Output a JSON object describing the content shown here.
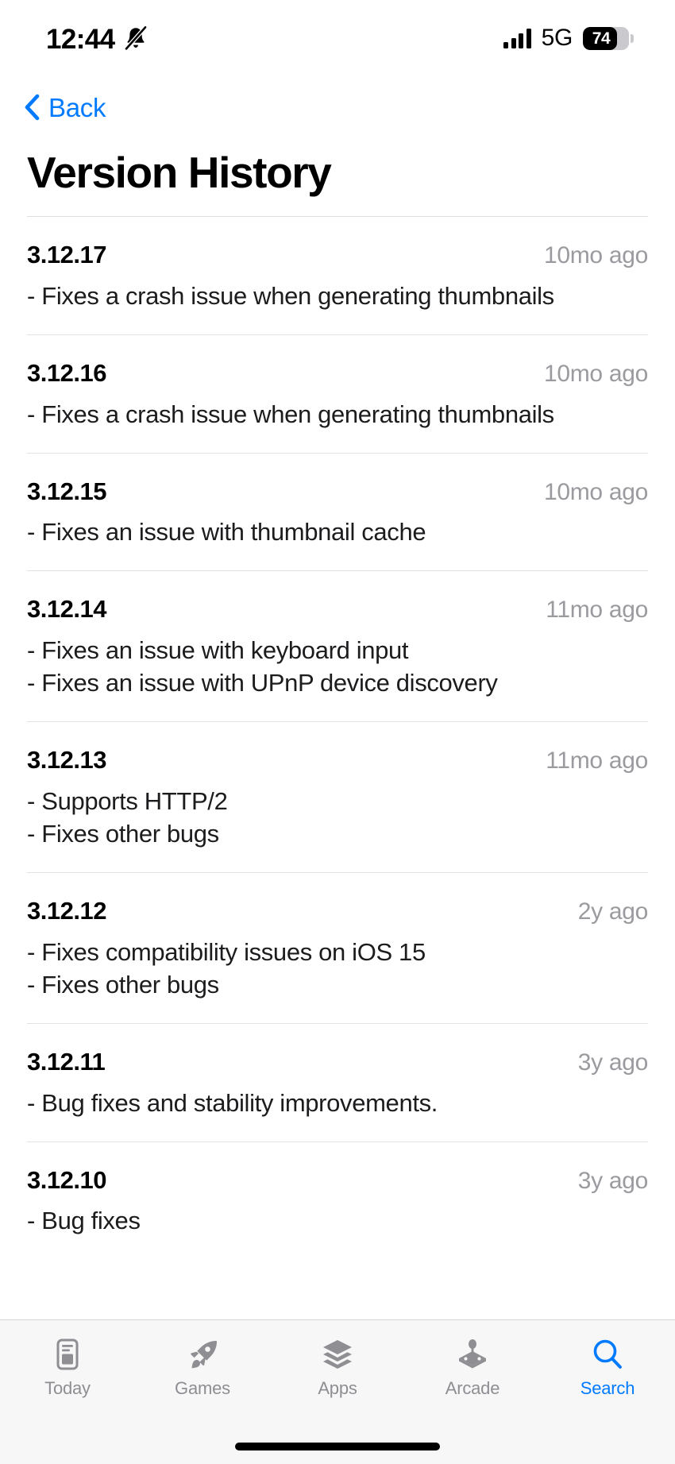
{
  "status_bar": {
    "time": "12:44",
    "silent_icon": "bell-slash-icon",
    "signal_icon": "cellular-bars-icon",
    "network": "5G",
    "battery_percent": "74",
    "battery_level": 74
  },
  "nav": {
    "back_label": "Back",
    "back_icon": "chevron-left-icon"
  },
  "header": {
    "title": "Version History"
  },
  "versions": [
    {
      "number": "3.12.17",
      "date": "10mo ago",
      "notes": "- Fixes a crash issue when generating thumbnails"
    },
    {
      "number": "3.12.16",
      "date": "10mo ago",
      "notes": "- Fixes a crash issue when generating thumbnails"
    },
    {
      "number": "3.12.15",
      "date": "10mo ago",
      "notes": "- Fixes an issue with thumbnail cache"
    },
    {
      "number": "3.12.14",
      "date": "11mo ago",
      "notes": "- Fixes an issue with keyboard input\n- Fixes an issue with UPnP device discovery"
    },
    {
      "number": "3.12.13",
      "date": "11mo ago",
      "notes": "- Supports HTTP/2\n- Fixes other bugs"
    },
    {
      "number": "3.12.12",
      "date": "2y ago",
      "notes": "- Fixes compatibility issues on iOS 15\n- Fixes other bugs"
    },
    {
      "number": "3.12.11",
      "date": "3y ago",
      "notes": "- Bug fixes and stability improvements."
    },
    {
      "number": "3.12.10",
      "date": "3y ago",
      "notes": "- Bug fixes"
    }
  ],
  "tab_bar": {
    "items": [
      {
        "label": "Today",
        "icon": "today-card-icon",
        "active": false
      },
      {
        "label": "Games",
        "icon": "rocket-icon",
        "active": false
      },
      {
        "label": "Apps",
        "icon": "stacked-layers-icon",
        "active": false
      },
      {
        "label": "Arcade",
        "icon": "joystick-icon",
        "active": false
      },
      {
        "label": "Search",
        "icon": "magnifier-icon",
        "active": true
      }
    ]
  },
  "colors": {
    "accent": "#007aff",
    "inactive_tab": "#8e8e93",
    "secondary_text": "#9a9a9f",
    "separator": "#e3e3e5",
    "tab_bar_bg": "#f7f7f7"
  }
}
